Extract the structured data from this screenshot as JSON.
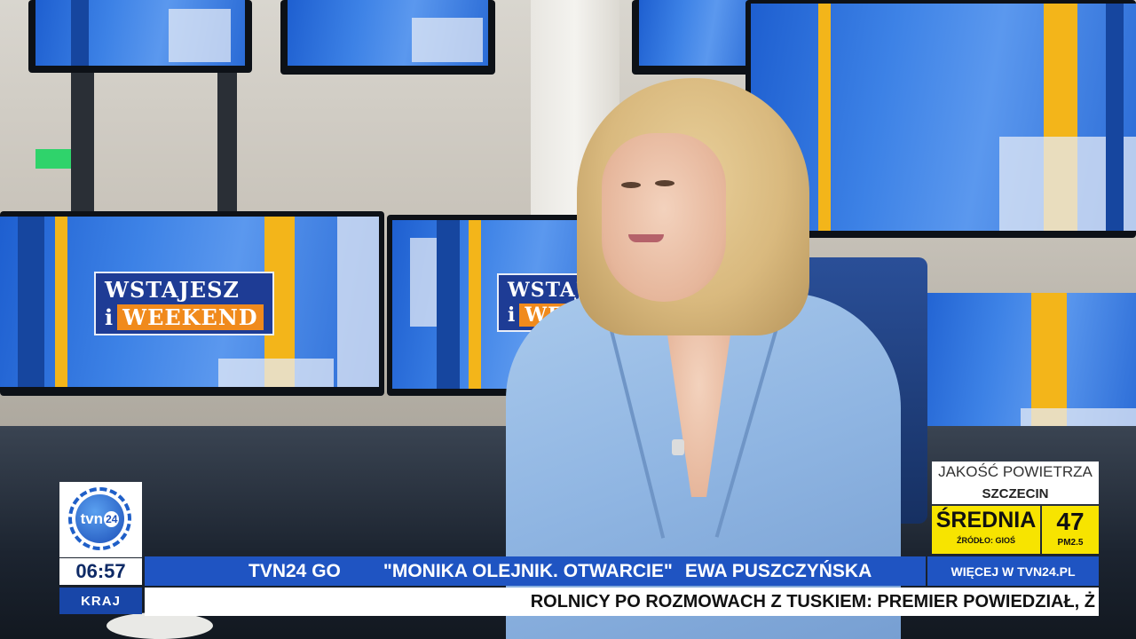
{
  "studio": {
    "show_logo_line1": "WSTAJESZ",
    "show_logo_line2_prefix": "i",
    "show_logo_line2_word": "WEEKEND"
  },
  "channel": {
    "logo_text": "tvn",
    "logo_number": "24",
    "clock": "06:57",
    "section": "KRAJ"
  },
  "lower_third": {
    "promo_label": "TVN24 GO",
    "show_title": "\"MONIKA OLEJNIK. OTWARCIE\"",
    "guest_name": "EWA PUSZCZYŃSKA",
    "ticker": "ROLNICY PO ROZMOWACH Z TUSKIEM: PREMIER POWIEDZIAŁ, Ż"
  },
  "air_quality": {
    "title": "JAKOŚĆ POWIETRZA",
    "city": "SZCZECIN",
    "level": "ŚREDNIA",
    "source": "ŹRÓDŁO: GIOŚ",
    "value": "47",
    "unit": "PM2.5",
    "more_link": "WIĘCEJ W TVN24.PL",
    "level_color": "#f7e400"
  },
  "colors": {
    "brand_blue": "#1f54c2",
    "section_blue": "#1846a8",
    "clock_text": "#0e2a66"
  }
}
